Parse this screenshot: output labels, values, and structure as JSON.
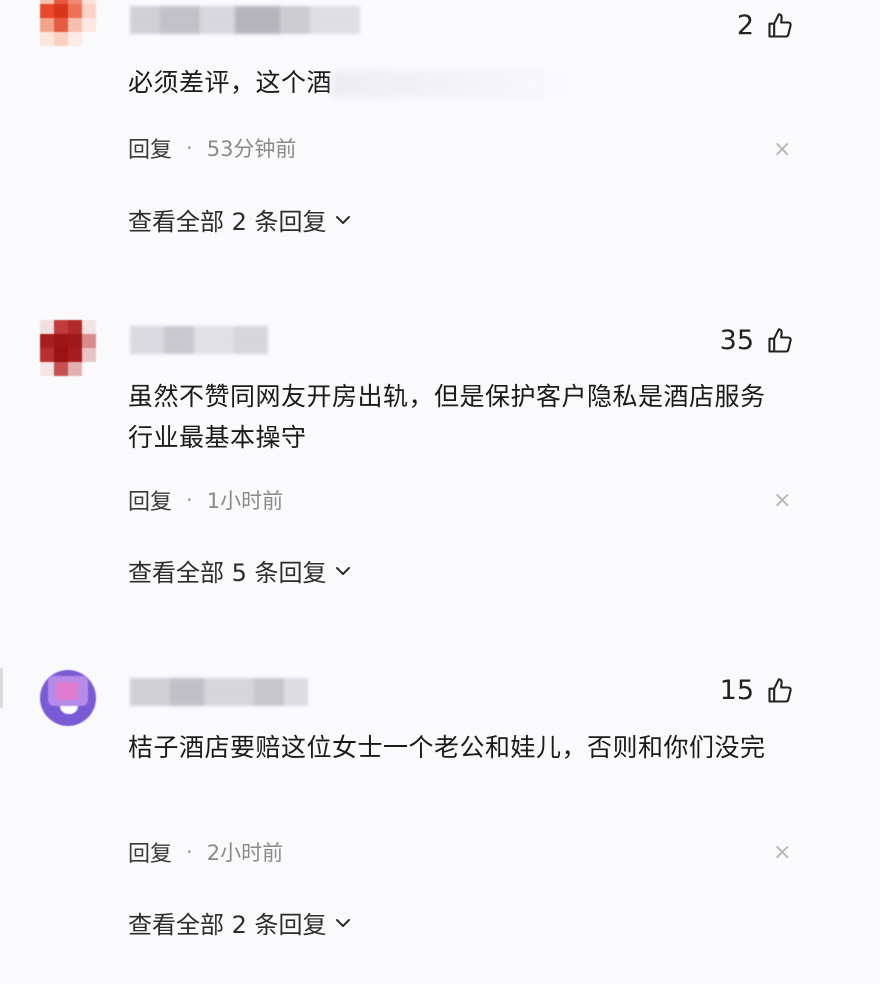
{
  "colors": {
    "background": "#fafafd",
    "text": "#1a1a1a",
    "meta": "#8a8a8a",
    "close": "#b5b5b5"
  },
  "comments": [
    {
      "avatar_style": "pixelated-orange",
      "likes": "2",
      "text": "必须差评，这个酒",
      "reply_label": "回复",
      "separator": "·",
      "time": "53分钟前",
      "close_glyph": "×",
      "view_all": "查看全部 2 条回复"
    },
    {
      "avatar_style": "pixelated-red",
      "likes": "35",
      "text": "虽然不赞同网友开房出轨，但是保护客户隐私是酒店服务行业最基本操守",
      "reply_label": "回复",
      "separator": "·",
      "time": "1小时前",
      "close_glyph": "×",
      "view_all": "查看全部 5 条回复"
    },
    {
      "avatar_style": "pixelated-purple",
      "likes": "15",
      "text": "桔子酒店要赔这位女士一个老公和娃儿，否则和你们没完",
      "reply_label": "回复",
      "separator": "·",
      "time": "2小时前",
      "close_glyph": "×",
      "view_all": "查看全部 2 条回复"
    }
  ],
  "icons": {
    "like": "thumbs-up-icon",
    "close": "close-icon",
    "expand": "chevron-down-icon"
  }
}
